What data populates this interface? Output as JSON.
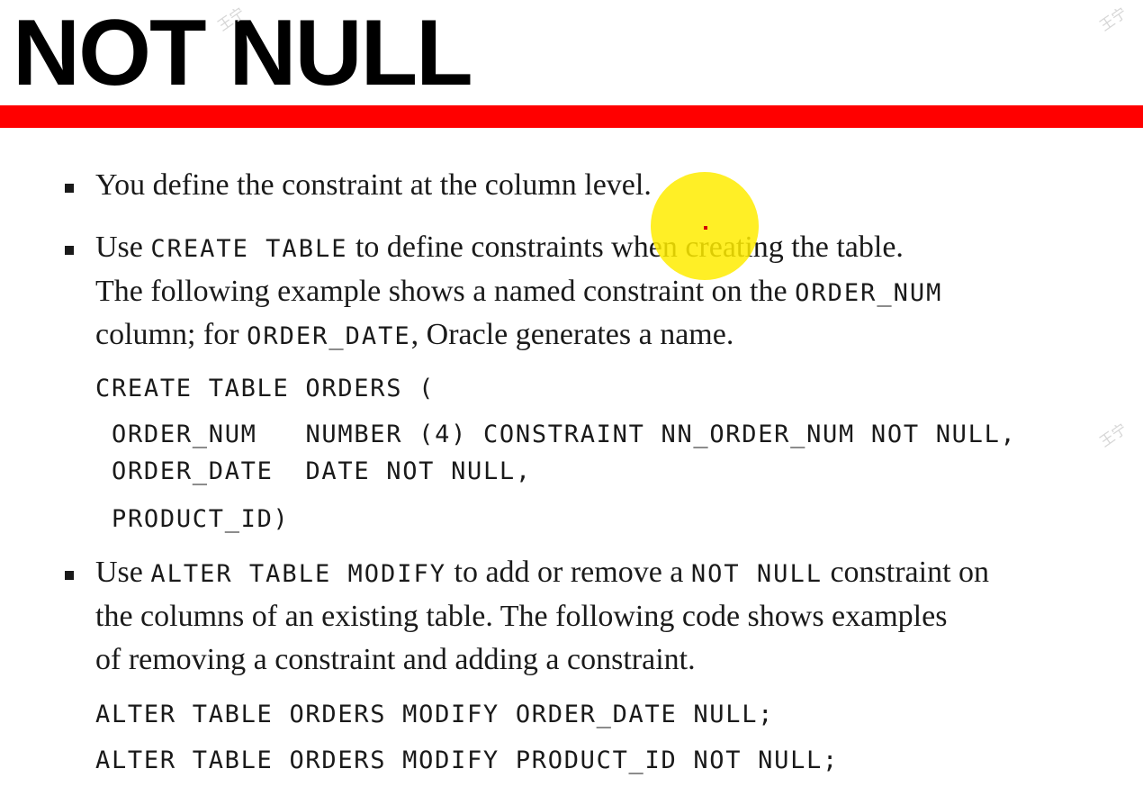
{
  "slide": {
    "title": "NOT NULL",
    "colors": {
      "title_rule": "#ff0000",
      "pointer_highlight": "#ffec00",
      "text": "#1a1a1a"
    }
  },
  "bullets": [
    {
      "line1": "You define the constraint at the column level."
    },
    {
      "line1_a": "Use ",
      "line1_code": "CREATE TABLE",
      "line1_b": " to define constraints when creating the table.",
      "line2_a": "The following example shows a named constraint on the ",
      "line2_code": "ORDER_NUM",
      "line3_a": "column; for ",
      "line3_code": "ORDER_DATE",
      "line3_b": ", Oracle generates a name.",
      "code": [
        "CREATE TABLE ORDERS (",
        "ORDER_NUM   NUMBER (4) CONSTRAINT NN_ORDER_NUM NOT NULL,",
        "ORDER_DATE  DATE NOT NULL,",
        "PRODUCT_ID)"
      ]
    },
    {
      "line1_a": "Use ",
      "line1_code": "ALTER TABLE MODIFY",
      "line1_b": " to add or remove a ",
      "line1_code2": "NOT NULL",
      "line1_c": " constraint on",
      "line2": "the columns of an existing table. The following code shows examples",
      "line3": "of removing a constraint and adding a constraint.",
      "code": [
        "ALTER TABLE ORDERS MODIFY ORDER_DATE NULL;",
        "ALTER TABLE ORDERS MODIFY PRODUCT_ID NOT NULL;"
      ]
    }
  ],
  "watermark": {
    "text": "王宁"
  }
}
